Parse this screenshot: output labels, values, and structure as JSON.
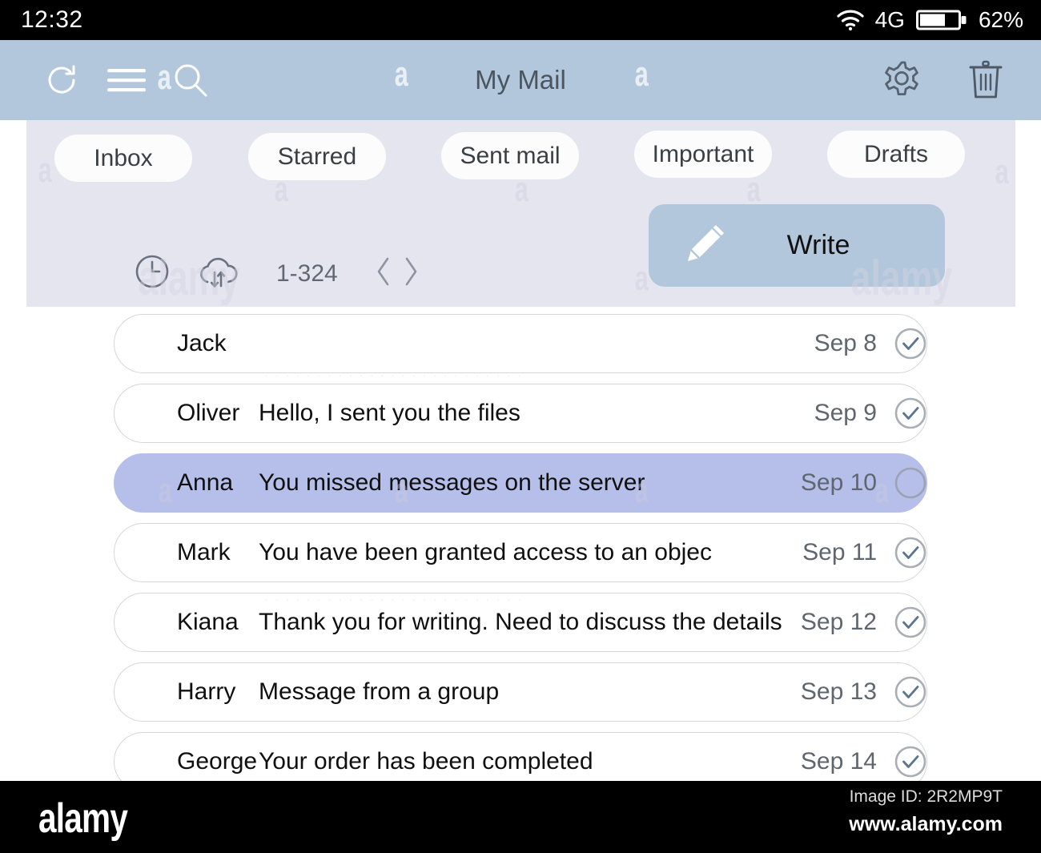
{
  "status_bar": {
    "time": "12:32",
    "network": "4G",
    "battery_percent": "62%",
    "battery_level": 62,
    "wifi_icon": "wifi-icon",
    "battery_icon": "battery-icon"
  },
  "header": {
    "title": "My Mail",
    "refresh_icon": "refresh-icon",
    "menu_icon": "hamburger-menu-icon",
    "search_icon": "search-icon",
    "settings_icon": "gear-icon",
    "trash_icon": "trash-icon",
    "background_color": "#b3c7dc"
  },
  "tabs": [
    {
      "label": "Inbox",
      "active": true
    },
    {
      "label": "Starred",
      "active": false
    },
    {
      "label": "Sent mail",
      "active": false
    },
    {
      "label": "Important",
      "active": false
    },
    {
      "label": "Drafts",
      "active": false
    }
  ],
  "toolbar": {
    "clock_icon": "clock-icon",
    "sync_icon": "cloud-sync-icon",
    "range": "1-324",
    "prev_icon": "chevron-left-icon",
    "next_icon": "chevron-right-icon"
  },
  "write_button": {
    "label": "Write",
    "icon": "pencil-icon",
    "color": "#b3c7dc"
  },
  "mail": {
    "selected_color": "#b6bfea",
    "items": [
      {
        "sender": "Jack",
        "preview": "",
        "date": "Sep 8",
        "checked": true,
        "selected": false
      },
      {
        "sender": "Oliver",
        "preview": "Hello, I sent you the files",
        "date": "Sep 9",
        "checked": true,
        "selected": false
      },
      {
        "sender": "Anna",
        "preview": "You missed messages on the server",
        "date": "Sep 10",
        "checked": false,
        "selected": true
      },
      {
        "sender": "Mark",
        "preview": "You have been granted access to an objec",
        "date": "Sep 11",
        "checked": true,
        "selected": false
      },
      {
        "sender": "Kiana",
        "preview": "Thank you for writing. Need to discuss the details",
        "date": "Sep 12",
        "checked": true,
        "selected": false
      },
      {
        "sender": "Harry",
        "preview": "Message from a group",
        "date": "Sep 13",
        "checked": true,
        "selected": false
      },
      {
        "sender": "George",
        "preview": "Your order has been completed",
        "date": "Sep 14",
        "checked": true,
        "selected": false
      }
    ]
  },
  "footer": {
    "logo": "alamy",
    "image_id": "Image ID: 2R2MP9T",
    "url": "www.alamy.com"
  },
  "watermark": {
    "text": "a",
    "brand": "alamy"
  }
}
